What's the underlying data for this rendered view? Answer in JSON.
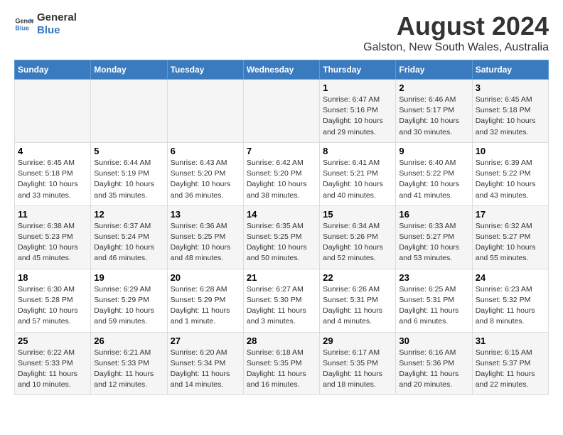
{
  "logo": {
    "line1": "General",
    "line2": "Blue"
  },
  "title": "August 2024",
  "subtitle": "Galston, New South Wales, Australia",
  "days_of_week": [
    "Sunday",
    "Monday",
    "Tuesday",
    "Wednesday",
    "Thursday",
    "Friday",
    "Saturday"
  ],
  "weeks": [
    [
      {
        "day": "",
        "sunrise": "",
        "sunset": "",
        "daylight": ""
      },
      {
        "day": "",
        "sunrise": "",
        "sunset": "",
        "daylight": ""
      },
      {
        "day": "",
        "sunrise": "",
        "sunset": "",
        "daylight": ""
      },
      {
        "day": "",
        "sunrise": "",
        "sunset": "",
        "daylight": ""
      },
      {
        "day": "1",
        "sunrise": "Sunrise: 6:47 AM",
        "sunset": "Sunset: 5:16 PM",
        "daylight": "Daylight: 10 hours and 29 minutes."
      },
      {
        "day": "2",
        "sunrise": "Sunrise: 6:46 AM",
        "sunset": "Sunset: 5:17 PM",
        "daylight": "Daylight: 10 hours and 30 minutes."
      },
      {
        "day": "3",
        "sunrise": "Sunrise: 6:45 AM",
        "sunset": "Sunset: 5:18 PM",
        "daylight": "Daylight: 10 hours and 32 minutes."
      }
    ],
    [
      {
        "day": "4",
        "sunrise": "Sunrise: 6:45 AM",
        "sunset": "Sunset: 5:18 PM",
        "daylight": "Daylight: 10 hours and 33 minutes."
      },
      {
        "day": "5",
        "sunrise": "Sunrise: 6:44 AM",
        "sunset": "Sunset: 5:19 PM",
        "daylight": "Daylight: 10 hours and 35 minutes."
      },
      {
        "day": "6",
        "sunrise": "Sunrise: 6:43 AM",
        "sunset": "Sunset: 5:20 PM",
        "daylight": "Daylight: 10 hours and 36 minutes."
      },
      {
        "day": "7",
        "sunrise": "Sunrise: 6:42 AM",
        "sunset": "Sunset: 5:20 PM",
        "daylight": "Daylight: 10 hours and 38 minutes."
      },
      {
        "day": "8",
        "sunrise": "Sunrise: 6:41 AM",
        "sunset": "Sunset: 5:21 PM",
        "daylight": "Daylight: 10 hours and 40 minutes."
      },
      {
        "day": "9",
        "sunrise": "Sunrise: 6:40 AM",
        "sunset": "Sunset: 5:22 PM",
        "daylight": "Daylight: 10 hours and 41 minutes."
      },
      {
        "day": "10",
        "sunrise": "Sunrise: 6:39 AM",
        "sunset": "Sunset: 5:22 PM",
        "daylight": "Daylight: 10 hours and 43 minutes."
      }
    ],
    [
      {
        "day": "11",
        "sunrise": "Sunrise: 6:38 AM",
        "sunset": "Sunset: 5:23 PM",
        "daylight": "Daylight: 10 hours and 45 minutes."
      },
      {
        "day": "12",
        "sunrise": "Sunrise: 6:37 AM",
        "sunset": "Sunset: 5:24 PM",
        "daylight": "Daylight: 10 hours and 46 minutes."
      },
      {
        "day": "13",
        "sunrise": "Sunrise: 6:36 AM",
        "sunset": "Sunset: 5:25 PM",
        "daylight": "Daylight: 10 hours and 48 minutes."
      },
      {
        "day": "14",
        "sunrise": "Sunrise: 6:35 AM",
        "sunset": "Sunset: 5:25 PM",
        "daylight": "Daylight: 10 hours and 50 minutes."
      },
      {
        "day": "15",
        "sunrise": "Sunrise: 6:34 AM",
        "sunset": "Sunset: 5:26 PM",
        "daylight": "Daylight: 10 hours and 52 minutes."
      },
      {
        "day": "16",
        "sunrise": "Sunrise: 6:33 AM",
        "sunset": "Sunset: 5:27 PM",
        "daylight": "Daylight: 10 hours and 53 minutes."
      },
      {
        "day": "17",
        "sunrise": "Sunrise: 6:32 AM",
        "sunset": "Sunset: 5:27 PM",
        "daylight": "Daylight: 10 hours and 55 minutes."
      }
    ],
    [
      {
        "day": "18",
        "sunrise": "Sunrise: 6:30 AM",
        "sunset": "Sunset: 5:28 PM",
        "daylight": "Daylight: 10 hours and 57 minutes."
      },
      {
        "day": "19",
        "sunrise": "Sunrise: 6:29 AM",
        "sunset": "Sunset: 5:29 PM",
        "daylight": "Daylight: 10 hours and 59 minutes."
      },
      {
        "day": "20",
        "sunrise": "Sunrise: 6:28 AM",
        "sunset": "Sunset: 5:29 PM",
        "daylight": "Daylight: 11 hours and 1 minute."
      },
      {
        "day": "21",
        "sunrise": "Sunrise: 6:27 AM",
        "sunset": "Sunset: 5:30 PM",
        "daylight": "Daylight: 11 hours and 3 minutes."
      },
      {
        "day": "22",
        "sunrise": "Sunrise: 6:26 AM",
        "sunset": "Sunset: 5:31 PM",
        "daylight": "Daylight: 11 hours and 4 minutes."
      },
      {
        "day": "23",
        "sunrise": "Sunrise: 6:25 AM",
        "sunset": "Sunset: 5:31 PM",
        "daylight": "Daylight: 11 hours and 6 minutes."
      },
      {
        "day": "24",
        "sunrise": "Sunrise: 6:23 AM",
        "sunset": "Sunset: 5:32 PM",
        "daylight": "Daylight: 11 hours and 8 minutes."
      }
    ],
    [
      {
        "day": "25",
        "sunrise": "Sunrise: 6:22 AM",
        "sunset": "Sunset: 5:33 PM",
        "daylight": "Daylight: 11 hours and 10 minutes."
      },
      {
        "day": "26",
        "sunrise": "Sunrise: 6:21 AM",
        "sunset": "Sunset: 5:33 PM",
        "daylight": "Daylight: 11 hours and 12 minutes."
      },
      {
        "day": "27",
        "sunrise": "Sunrise: 6:20 AM",
        "sunset": "Sunset: 5:34 PM",
        "daylight": "Daylight: 11 hours and 14 minutes."
      },
      {
        "day": "28",
        "sunrise": "Sunrise: 6:18 AM",
        "sunset": "Sunset: 5:35 PM",
        "daylight": "Daylight: 11 hours and 16 minutes."
      },
      {
        "day": "29",
        "sunrise": "Sunrise: 6:17 AM",
        "sunset": "Sunset: 5:35 PM",
        "daylight": "Daylight: 11 hours and 18 minutes."
      },
      {
        "day": "30",
        "sunrise": "Sunrise: 6:16 AM",
        "sunset": "Sunset: 5:36 PM",
        "daylight": "Daylight: 11 hours and 20 minutes."
      },
      {
        "day": "31",
        "sunrise": "Sunrise: 6:15 AM",
        "sunset": "Sunset: 5:37 PM",
        "daylight": "Daylight: 11 hours and 22 minutes."
      }
    ]
  ]
}
